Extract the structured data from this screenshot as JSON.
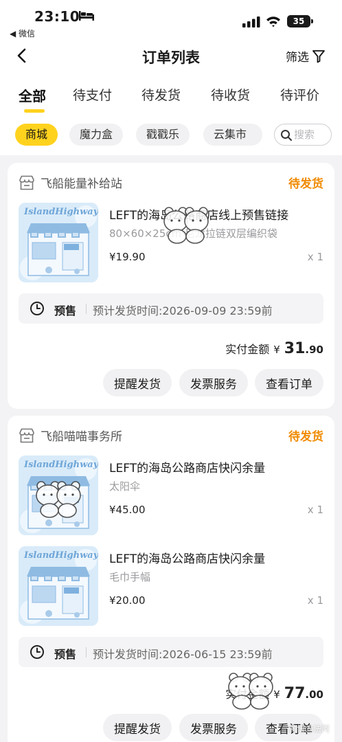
{
  "status_bar": {
    "time": "23:10",
    "back_to_app": "◀ 微信",
    "battery": "35"
  },
  "nav": {
    "title": "订单列表",
    "filter_label": "筛选"
  },
  "tabs": [
    {
      "label": "全部",
      "active": true
    },
    {
      "label": "待支付",
      "active": false
    },
    {
      "label": "待发货",
      "active": false
    },
    {
      "label": "待收货",
      "active": false
    },
    {
      "label": "待评价",
      "active": false
    }
  ],
  "chips": [
    {
      "label": "商城",
      "active": true
    },
    {
      "label": "魔力盒",
      "active": false
    },
    {
      "label": "戳戳乐",
      "active": false
    },
    {
      "label": "云集市",
      "active": false
    }
  ],
  "search": {
    "placeholder": "搜索"
  },
  "orders": [
    {
      "store": "飞船能量补给站",
      "status": "待发货",
      "items": [
        {
          "title": "LEFT的海岛公路商店线上预售链接",
          "spec": "80×60×25cm 尼龙拉链双层编织袋",
          "price": "¥19.90",
          "qty": "x 1",
          "thumb_text": "IslandHighway"
        }
      ],
      "presale": {
        "tag": "预售",
        "text": "预计发货时间:2026-09-09 23:59前"
      },
      "total": {
        "label": "实付金额",
        "currency": "¥",
        "integer": "31",
        "decimal": ".90"
      },
      "actions": [
        "提醒发货",
        "发票服务",
        "查看订单"
      ]
    },
    {
      "store": "飞船喵喵事务所",
      "status": "待发货",
      "items": [
        {
          "title": "LEFT的海岛公路商店快闪余量",
          "spec": "太阳伞",
          "price": "¥45.00",
          "qty": "x 1",
          "thumb_text": "IslandHighway"
        },
        {
          "title": "LEFT的海岛公路商店快闪余量",
          "spec": "毛巾手幅",
          "price": "¥20.00",
          "qty": "x 1",
          "thumb_text": "IslandHighway"
        }
      ],
      "presale": {
        "tag": "预售",
        "text": "预计发货时间:2026-06-15 23:59前"
      },
      "total": {
        "label": "实付金额",
        "currency": "¥",
        "integer": "77",
        "decimal": ".00"
      },
      "actions": [
        "提醒发货",
        "发票服务",
        "查看订单"
      ]
    }
  ],
  "watermark": {
    "text": "微博@法阿"
  },
  "colors": {
    "accent": "#ffd21e",
    "status_orange": "#f08a00",
    "page_bg": "#f3f3f5"
  }
}
